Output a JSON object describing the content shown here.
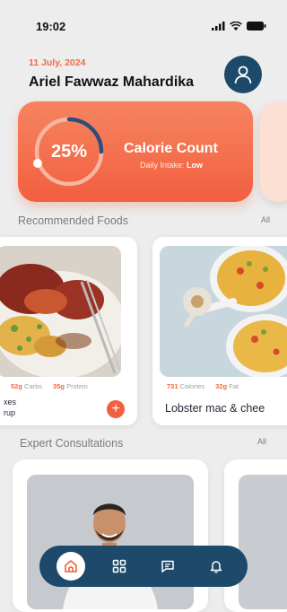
{
  "status": {
    "time": "19:02"
  },
  "header": {
    "date": "11 July, 2024",
    "user_name": "Ariel Fawwaz Mahardika"
  },
  "calorie": {
    "percent": "25%",
    "percent_value": 0.25,
    "title": "Calorie Count",
    "sub_label": "Daily Intake:",
    "sub_value": "Low"
  },
  "recommended": {
    "title": "Recommended Foods",
    "all_label": "All",
    "foods": [
      {
        "name_partial": "xes\nrup",
        "stat1_value": "52g",
        "stat1_label": "Carbs",
        "stat2_value": "35g",
        "stat2_label": "Protein",
        "add_label": "+"
      },
      {
        "name": "Lobster mac & chee",
        "stat1_value": "731",
        "stat1_label": "Calories",
        "stat2_value": "32g",
        "stat2_label": "Fat"
      }
    ]
  },
  "experts": {
    "title": "Expert Consultations",
    "all_label": "All"
  },
  "colors": {
    "accent": "#f25f3f",
    "navy": "#1d4a6b",
    "background": "#ededed"
  },
  "nav": {
    "items": [
      "home-icon",
      "grid-icon",
      "chat-icon",
      "bell-icon"
    ],
    "active": "home-icon"
  }
}
